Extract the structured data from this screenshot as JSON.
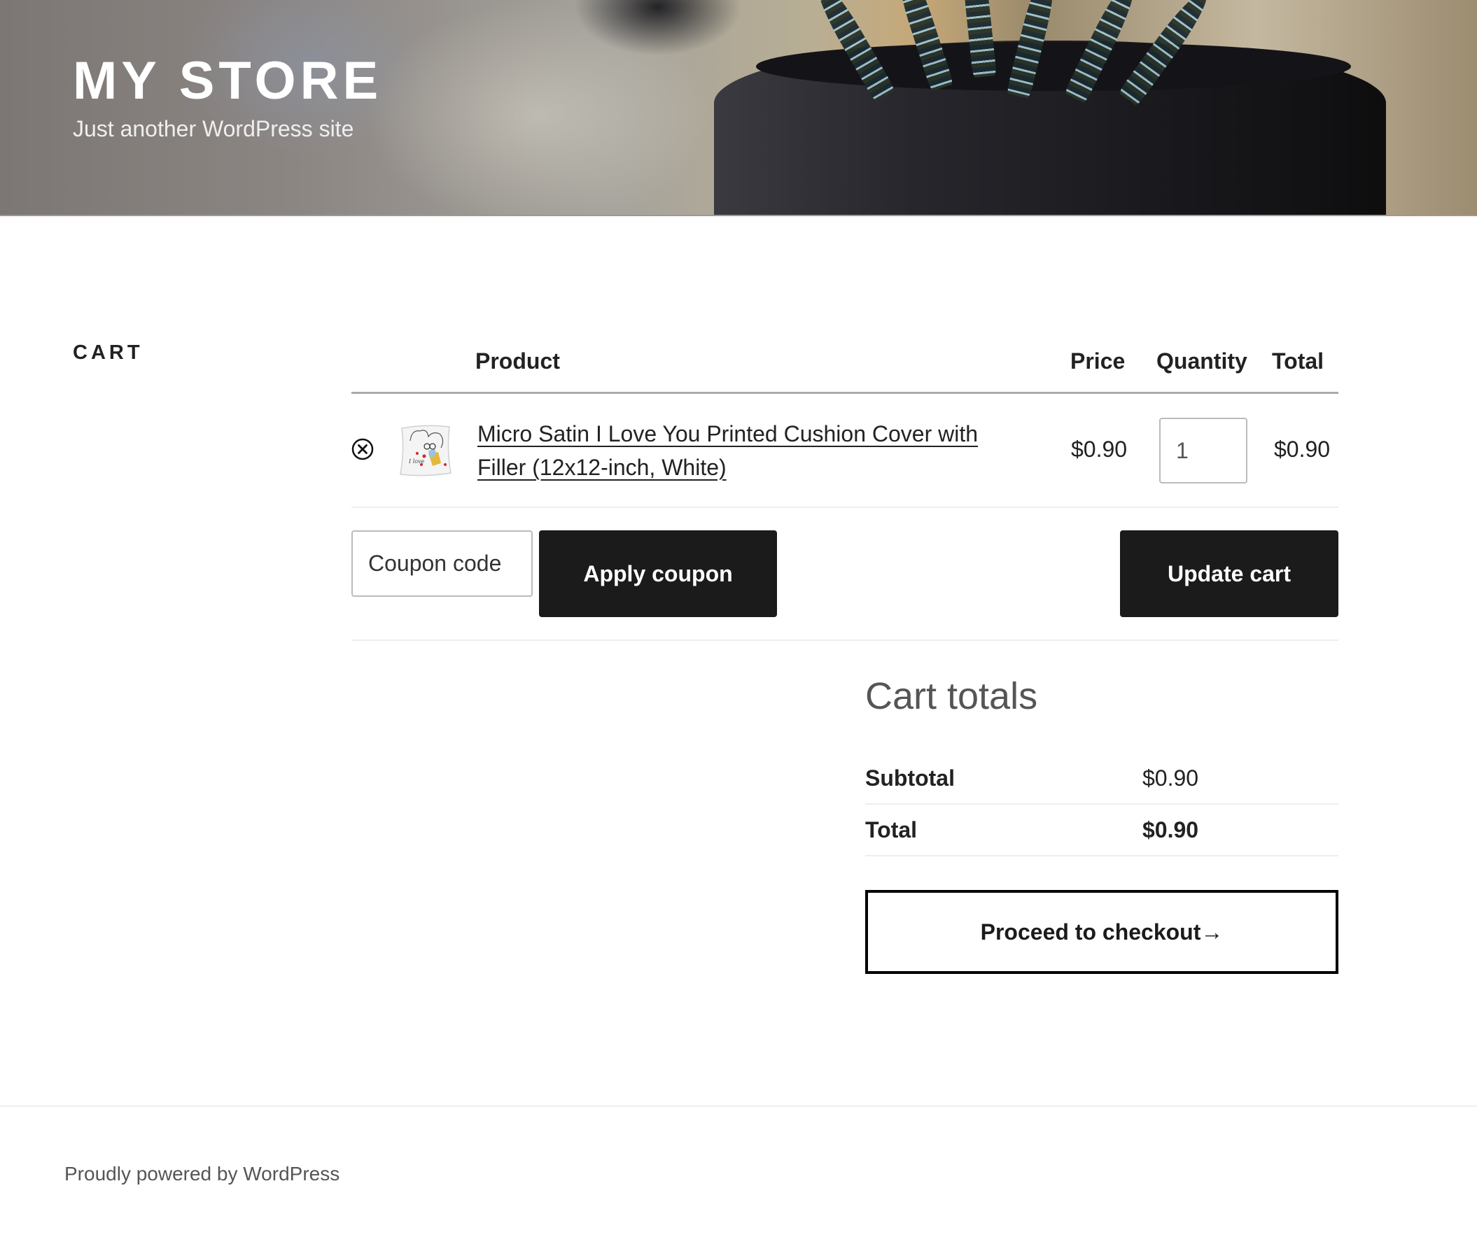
{
  "site": {
    "title": "MY STORE",
    "tagline": "Just another WordPress site"
  },
  "page": {
    "title": "CART"
  },
  "cart_table": {
    "headers": {
      "product": "Product",
      "price": "Price",
      "quantity": "Quantity",
      "total": "Total"
    },
    "items": [
      {
        "name": "Micro Satin I Love You Printed Cushion Cover with Filler (12x12-inch, White)",
        "price": "$0.90",
        "quantity": "1",
        "total": "$0.90",
        "remove_icon": "remove-circle-x-icon",
        "thumbnail": "cushion-thumbnail"
      }
    ]
  },
  "actions": {
    "coupon_placeholder": "Coupon code",
    "coupon_value": "",
    "apply_coupon_label": "Apply coupon",
    "update_cart_label": "Update cart"
  },
  "totals": {
    "title": "Cart totals",
    "subtotal_label": "Subtotal",
    "subtotal_value": "$0.90",
    "total_label": "Total",
    "total_value": "$0.90",
    "checkout_label": "Proceed to checkout→"
  },
  "footer": {
    "credit": "Proudly powered by WordPress"
  },
  "colors": {
    "button_dark": "#1b1b1b",
    "text": "#222222",
    "muted": "#555555",
    "divider": "#eeeeee"
  }
}
